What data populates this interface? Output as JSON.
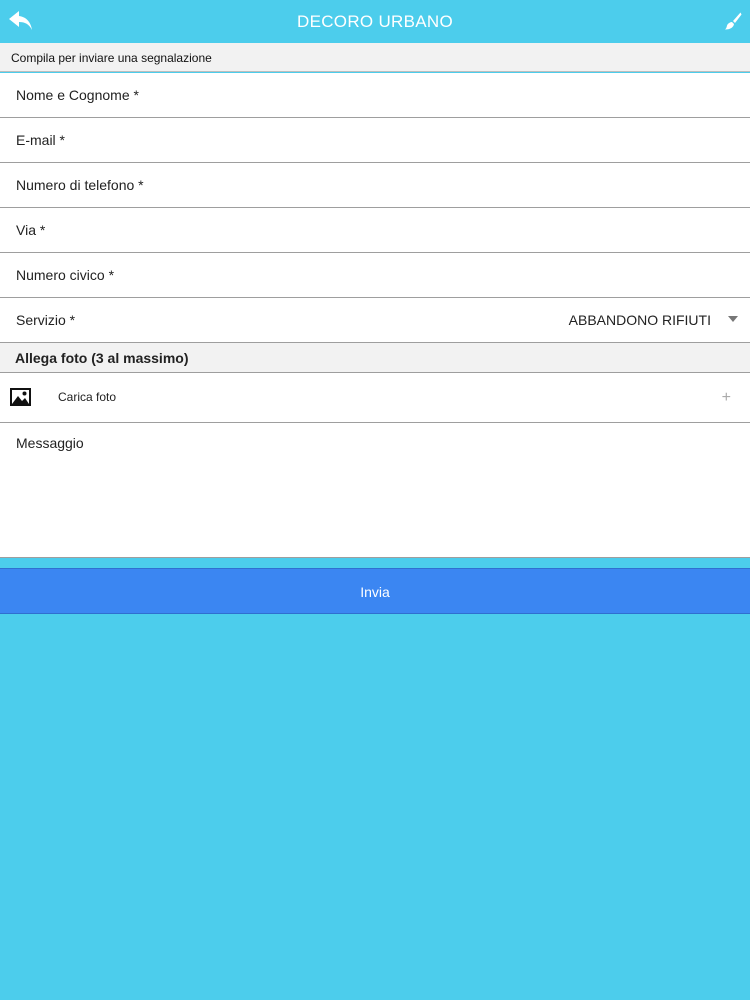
{
  "header": {
    "title": "DECORO URBANO",
    "back_icon": "back-arrow-icon",
    "right_icon": "brush-icon"
  },
  "intro": "Compila per inviare una segnalazione",
  "form": {
    "fields": [
      {
        "label": "Nome e Cognome *"
      },
      {
        "label": "E-mail *"
      },
      {
        "label": "Numero di telefono *"
      },
      {
        "label": "Via *"
      },
      {
        "label": "Numero civico *"
      }
    ],
    "service": {
      "label": "Servizio *",
      "value": "ABBANDONO RIFIUTI"
    },
    "photos": {
      "heading": "Allega foto (3 al massimo)",
      "upload_label": "Carica foto",
      "upload_icon": "image-icon",
      "add_symbol": "+"
    },
    "message_placeholder": "Messaggio",
    "submit_label": "Invia"
  },
  "colors": {
    "background": "#4ccdec",
    "submit": "#3b86f2"
  }
}
